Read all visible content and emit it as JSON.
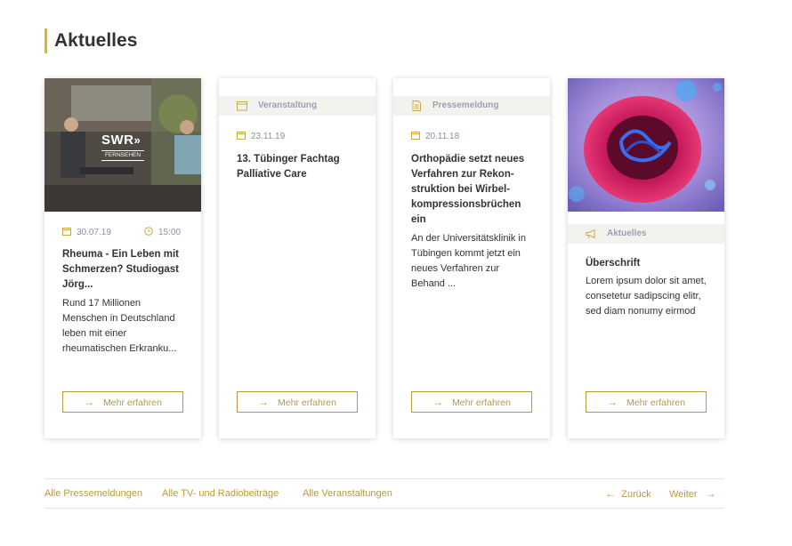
{
  "section": {
    "title": "Aktuelles"
  },
  "cards": [
    {
      "image": "swr-studio-photo",
      "logo_text": "SWR",
      "logo_sub": "FERNSEHEN",
      "date": "30.07.19",
      "time": "15:00",
      "title": "Rheuma - Ein Leben mit Schmerzen? Studiogast Jörg...",
      "text": "Rund 17 Millionen Menschen in Deutschland leben mit einer rheumatischen Erkranku...",
      "button": "Mehr erfahren"
    },
    {
      "category": "Veranstaltung",
      "category_icon": "calendar-icon",
      "date": "23.11.19",
      "title": "13. Tübinger Fachtag Palliative Care",
      "button": "Mehr erfahren"
    },
    {
      "category": "Pressemeldung",
      "category_icon": "document-icon",
      "date": "20.11.18",
      "title": "Orthopädie setzt neues Verfahren zur Rekon-struktion bei Wirbel-kompressionsbrüchen ein",
      "text": "An der Universitätsklinik in Tübingen kommt jetzt ein neues Verfahren zur Behand ...",
      "button": "Mehr erfahren"
    },
    {
      "image": "cell-illustration",
      "category": "Aktuelles",
      "category_icon": "megaphone-icon",
      "title": "Überschrift",
      "text": "Lorem ipsum dolor sit amet, consetetur sadipscing elitr, sed diam nonumy eirmod",
      "button": "Mehr erfahren"
    }
  ],
  "footer": {
    "links": [
      "Alle Pressemeldungen",
      "Alle TV- und Radiobeiträge",
      "Alle Veranstaltungen"
    ],
    "prev": "Zurück",
    "next": "Weiter"
  },
  "colors": {
    "accent": "#b89a3e",
    "title_bar": "#c8b46a",
    "meta": "#8a8fa8",
    "category_bg": "#f4f2ed"
  }
}
